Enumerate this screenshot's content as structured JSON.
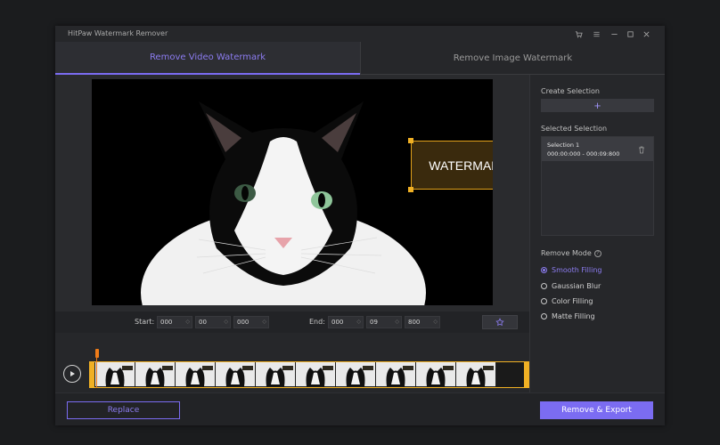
{
  "window": {
    "title": "HitPaw Watermark Remover",
    "controls": [
      "cart-icon",
      "menu-icon",
      "minimize-icon",
      "maximize-icon",
      "close-icon"
    ]
  },
  "tabs": [
    {
      "label": "Remove Video Watermark",
      "active": true
    },
    {
      "label": "Remove Image Watermark",
      "active": false
    }
  ],
  "preview": {
    "watermark_text": "WATERMARK"
  },
  "time_controls": {
    "start_label": "Start:",
    "start": [
      "000",
      "00",
      "000"
    ],
    "end_label": "End:",
    "end": [
      "000",
      "09",
      "800"
    ],
    "pin_icon": "pin-icon"
  },
  "timeline": {
    "play_icon": "play-icon"
  },
  "sidebar": {
    "create_title": "Create Selection",
    "create_symbol": "+",
    "selected_title": "Selected Selection",
    "selections": [
      {
        "name": "Selection 1",
        "range": "000:00:000 - 000:09:800"
      }
    ],
    "mode_title": "Remove Mode",
    "modes": [
      {
        "label": "Smooth Filling",
        "selected": true
      },
      {
        "label": "Gaussian Blur",
        "selected": false
      },
      {
        "label": "Color Filling",
        "selected": false
      },
      {
        "label": "Matte Filling",
        "selected": false
      }
    ]
  },
  "bottom": {
    "replace_label": "Replace",
    "export_label": "Remove & Export"
  },
  "colors": {
    "accent": "#7b6cf2",
    "selection_border": "#f0b024",
    "playhead": "#f07c18"
  }
}
